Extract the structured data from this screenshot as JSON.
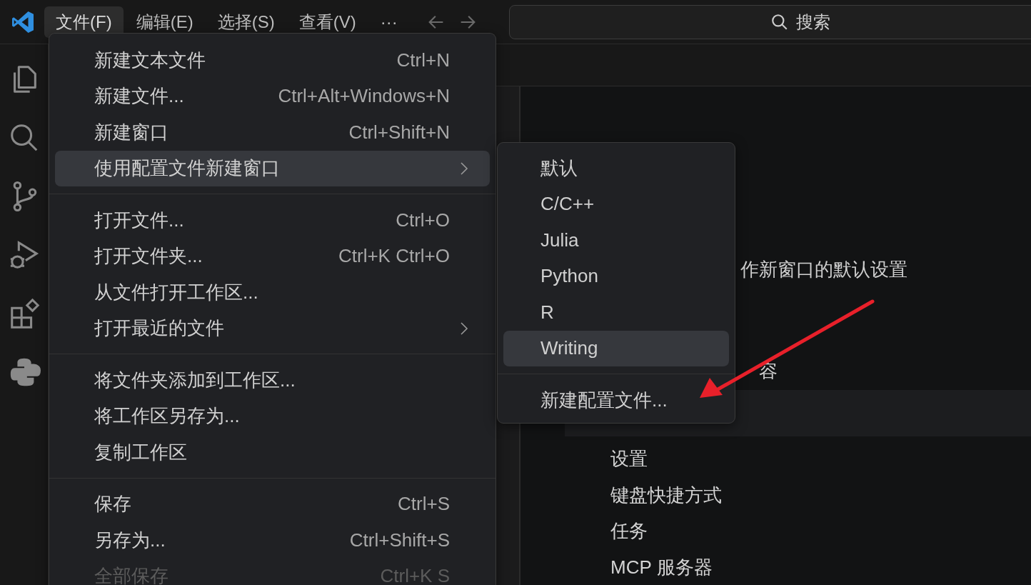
{
  "menu_bar": [
    {
      "label": "文件(F)",
      "selected": true
    },
    {
      "label": "编辑(E)",
      "selected": false
    },
    {
      "label": "选择(S)",
      "selected": false
    },
    {
      "label": "查看(V)",
      "selected": false
    },
    {
      "label": "···",
      "selected": false
    }
  ],
  "search": {
    "placeholder": "搜索"
  },
  "editor": {
    "description": "作新窗口的默认设置",
    "section_fragment": "容",
    "items": [
      "设置",
      "键盘快捷方式",
      "任务",
      "MCP 服务器"
    ]
  },
  "file_menu": [
    {
      "kind": "item",
      "label": "新建文本文件",
      "shortcut": "Ctrl+N",
      "selected": false,
      "disabled": false
    },
    {
      "kind": "item",
      "label": "新建文件...",
      "shortcut": "Ctrl+Alt+Windows+N",
      "selected": false,
      "disabled": false
    },
    {
      "kind": "item",
      "label": "新建窗口",
      "shortcut": "Ctrl+Shift+N",
      "selected": false,
      "disabled": false
    },
    {
      "kind": "submenu",
      "label": "使用配置文件新建窗口",
      "selected": true,
      "disabled": false
    },
    {
      "kind": "separator"
    },
    {
      "kind": "item",
      "label": "打开文件...",
      "shortcut": "Ctrl+O",
      "selected": false,
      "disabled": false
    },
    {
      "kind": "item",
      "label": "打开文件夹...",
      "shortcut": "Ctrl+K Ctrl+O",
      "selected": false,
      "disabled": false
    },
    {
      "kind": "item",
      "label": "从文件打开工作区...",
      "selected": false,
      "disabled": false
    },
    {
      "kind": "submenu",
      "label": "打开最近的文件",
      "selected": false,
      "disabled": false
    },
    {
      "kind": "separator"
    },
    {
      "kind": "item",
      "label": "将文件夹添加到工作区...",
      "selected": false,
      "disabled": false
    },
    {
      "kind": "item",
      "label": "将工作区另存为...",
      "selected": false,
      "disabled": false
    },
    {
      "kind": "item",
      "label": "复制工作区",
      "selected": false,
      "disabled": false
    },
    {
      "kind": "separator"
    },
    {
      "kind": "item",
      "label": "保存",
      "shortcut": "Ctrl+S",
      "selected": false,
      "disabled": false
    },
    {
      "kind": "item",
      "label": "另存为...",
      "shortcut": "Ctrl+Shift+S",
      "selected": false,
      "disabled": false
    },
    {
      "kind": "item",
      "label": "全部保存",
      "shortcut": "Ctrl+K S",
      "selected": false,
      "disabled": true
    }
  ],
  "profile_submenu": [
    {
      "kind": "item",
      "label": "默认",
      "selected": false
    },
    {
      "kind": "item",
      "label": "C/C++",
      "selected": false
    },
    {
      "kind": "item",
      "label": "Julia",
      "selected": false
    },
    {
      "kind": "item",
      "label": "Python",
      "selected": false
    },
    {
      "kind": "item",
      "label": "R",
      "selected": false
    },
    {
      "kind": "item",
      "label": "Writing",
      "selected": true
    },
    {
      "kind": "separator"
    },
    {
      "kind": "item",
      "label": "新建配置文件...",
      "selected": false
    }
  ]
}
